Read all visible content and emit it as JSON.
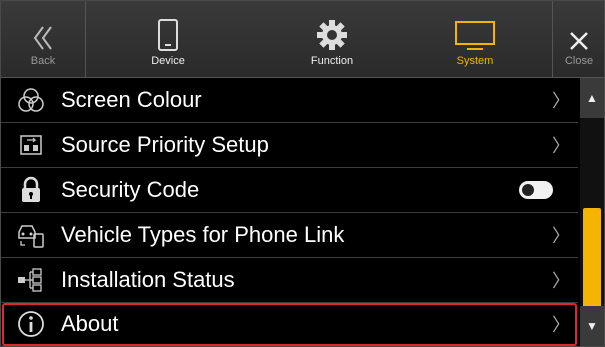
{
  "topbar": {
    "back_label": "Back",
    "device_label": "Device",
    "function_label": "Function",
    "system_label": "System",
    "close_label": "Close",
    "active_tab": "System",
    "accent_color": "#f4b400"
  },
  "list": {
    "items": [
      {
        "label": "Screen Colour",
        "icon": "color-circles-icon",
        "control": "chevron"
      },
      {
        "label": "Source Priority Setup",
        "icon": "source-priority-icon",
        "control": "chevron"
      },
      {
        "label": "Security Code",
        "icon": "lock-icon",
        "control": "toggle",
        "toggle_state": "off"
      },
      {
        "label": "Vehicle Types for Phone Link",
        "icon": "car-phone-icon",
        "control": "chevron"
      },
      {
        "label": "Installation Status",
        "icon": "installation-tree-icon",
        "control": "chevron"
      },
      {
        "label": "About",
        "icon": "info-icon",
        "control": "chevron",
        "highlighted": true
      }
    ],
    "chevron_glyph": "〉"
  },
  "scrollbar": {
    "up_glyph": "▲",
    "down_glyph": "▼",
    "thumb_color": "#f4b400"
  },
  "highlight_color": "#e0262f"
}
